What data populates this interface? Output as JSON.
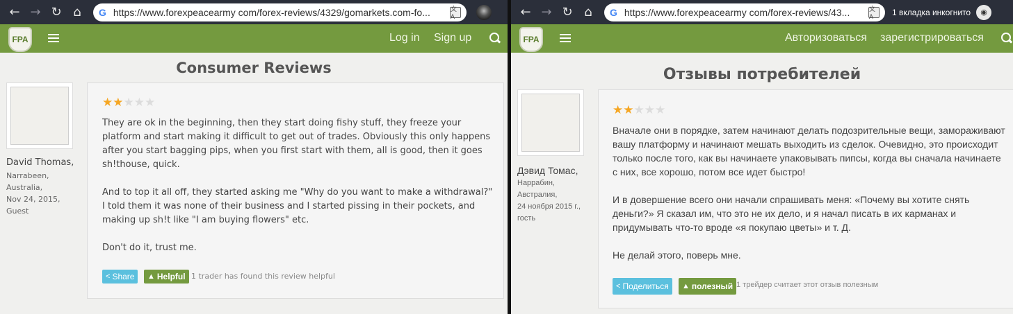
{
  "left": {
    "url": "https://www.forexpeacearmy com/forex-reviews/4329/gomarkets.com-fo...",
    "logo_text": "FPA",
    "header": {
      "login": "Log in",
      "signup": "Sign up"
    },
    "page_title": "Consumer Reviews",
    "user": {
      "name": "David Thomas,",
      "location1": "Narrabeen,",
      "location2": "Australia,",
      "date": "Nov 24, 2015,",
      "role": "Guest"
    },
    "rating": 2,
    "review": [
      "They are ok in the beginning, then they start doing fishy stuff, they freeze your platform and start making it difficult to get out of trades. Obviously this only happens after you start bagging pips, when you first start with them, all is good, then it goes sh!thouse, quick.",
      "And to top it all off, they started asking me \"Why do you want to make a withdrawal?\" I told them it was none of their business and I started pissing in their pockets, and making up sh!t like \"I am buying flowers\" etc.",
      "Don't do it, trust me."
    ],
    "share_label": "Share",
    "helpful_label": "Helpful",
    "helpful_note": "1 trader has found this review helpful"
  },
  "right": {
    "url": "https://www.forexpeacearmy com/forex-reviews/43...",
    "incognito": "1 вкладка инкогнито",
    "logo_text": "FPA",
    "header": {
      "login": "Авторизоваться",
      "signup": "зарегистрироваться"
    },
    "page_title": "Отзывы потребителей",
    "user": {
      "name": "Дэвид Томас,",
      "location1": "Наррабин,",
      "location2": "Австралия,",
      "date": "24 ноября 2015 г.,",
      "role": "гость"
    },
    "rating": 2,
    "review": [
      "Вначале они в порядке, затем начинают делать подозрительные вещи, замораживают вашу платформу и начинают мешать выходить из сделок. Очевидно, это происходит только после того, как вы начинаете упаковывать пипсы, когда вы сначала начинаете с них, все хорошо, потом все идет быстро!",
      "И в довершение всего они начали спрашивать меня: «Почему вы хотите снять деньги?» Я сказал им, что это не их дело, и я начал писать в их карманах и придумывать что-то вроде «я покупаю цветы» и т. Д.",
      "Не делай этого, поверь мне."
    ],
    "share_label": "Поделиться",
    "helpful_label": "полезный",
    "helpful_note": "1 трейдер считает этот отзыв полезным"
  },
  "colors": {
    "header_green": "#749a3f",
    "star_gold": "#f5a623",
    "share_blue": "#5bc0de",
    "chrome_dark": "#2b2f3a"
  },
  "icons": [
    "back-arrow-icon",
    "forward-arrow-icon",
    "reload-icon",
    "home-icon",
    "google-icon",
    "translate-icon",
    "hamburger-menu-icon",
    "search-icon",
    "share-icon",
    "thumbs-up-icon",
    "incognito-icon"
  ]
}
